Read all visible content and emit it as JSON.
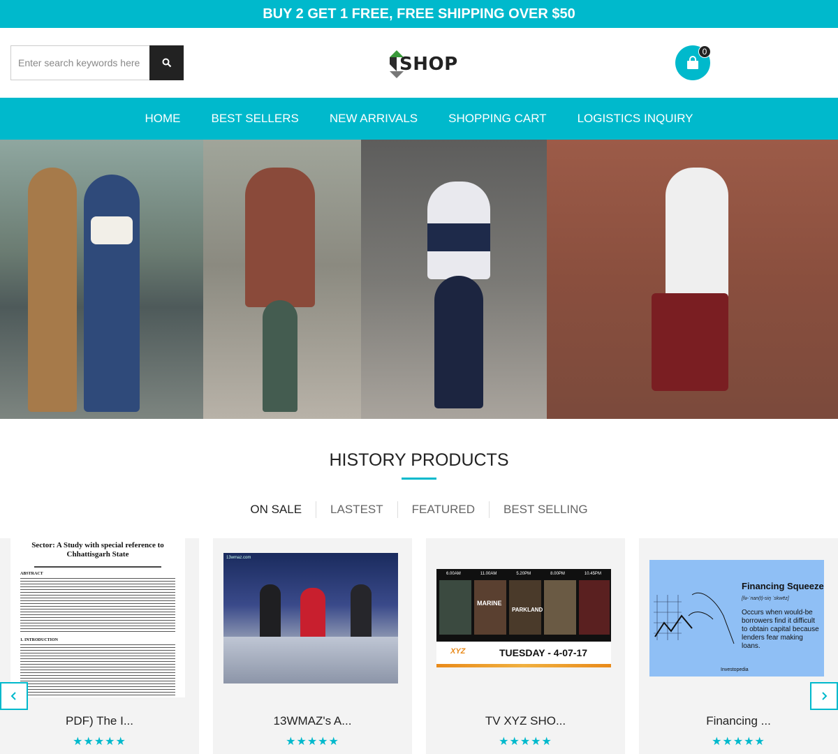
{
  "promo": {
    "text": "BUY 2 GET 1 FREE, FREE SHIPPING OVER $50"
  },
  "search": {
    "placeholder": "Enter search keywords here"
  },
  "logo": {
    "text": "SHOP"
  },
  "cart": {
    "count": "0"
  },
  "nav": {
    "items": [
      "HOME",
      "BEST SELLERS",
      "NEW ARRIVALS",
      "SHOPPING CART",
      "LOGISTICS INQUIRY"
    ]
  },
  "section": {
    "title": "HISTORY PRODUCTS"
  },
  "tabs": [
    "ON SALE",
    "LASTEST",
    "FEATURED",
    "BEST SELLING"
  ],
  "products": [
    {
      "name": "PDF) The I...",
      "rating": "★★★★★",
      "thumb": {
        "heading": "Sector: A Study with special reference to Chhattisgarh State",
        "section1": "ABSTRACT",
        "section2": "1.  INTRODUCTION"
      }
    },
    {
      "name": "13WMAZ's A...",
      "rating": "★★★★★",
      "thumb": {
        "caption": "13wmaz.com"
      }
    },
    {
      "name": "TV XYZ SHO...",
      "rating": "★★★★★",
      "thumb": {
        "times": [
          "6.00AM",
          "11.00AM",
          "5.20PM",
          "8.00PM",
          "10.45PM"
        ],
        "titles": [
          "MARINE",
          "PARKLAND"
        ],
        "logo": "XYZ",
        "date": "TUESDAY - 4-07-17"
      }
    },
    {
      "name": "Financing ...",
      "rating": "★★★★★",
      "thumb": {
        "title": "Financing Squeeze",
        "phonetic": "[fə-ˈnan(t)-siŋ ˈskwēz]",
        "definition": "Occurs when would-be borrowers find it difficult to obtain capital because lenders fear making loans.",
        "brand": "Investopedia"
      }
    }
  ],
  "colors": {
    "accent": "#00b9cc",
    "dark": "#222222"
  }
}
